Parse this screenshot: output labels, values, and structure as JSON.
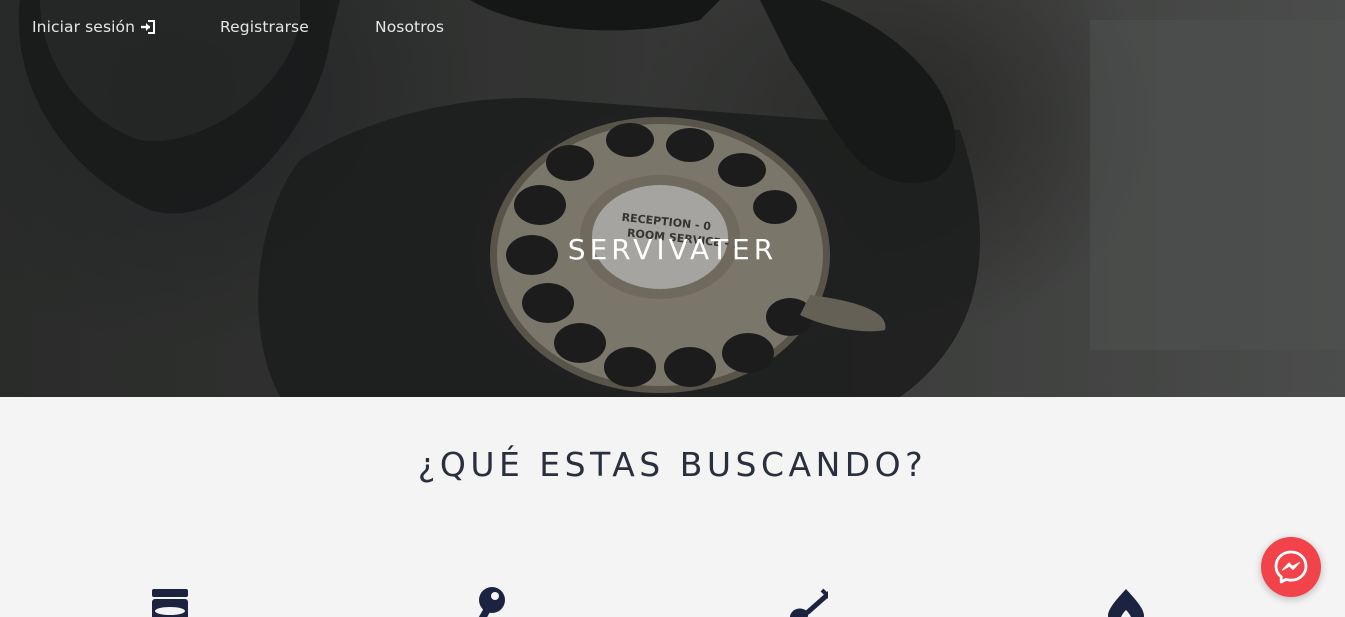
{
  "nav": {
    "login_label": "Iniciar sesión",
    "login_icon": "sign-in-icon",
    "register_label": "Registrarse",
    "about_label": "Nosotros"
  },
  "hero": {
    "brand": "SERVIVATER",
    "image": "rotary-telephone-photo",
    "dial_text_1": "RECEPTION - 0",
    "dial_text_2": "ROOM SERVICE - 1"
  },
  "section": {
    "title": "¿QUÉ ESTAS BUSCANDO?"
  },
  "services": [
    {
      "icon": "water-heater-icon"
    },
    {
      "icon": "key-icon"
    },
    {
      "icon": "paint-brush-icon"
    },
    {
      "icon": "gas-flame-icon"
    }
  ],
  "chat": {
    "icon": "messenger-icon",
    "color": "#f2424a"
  },
  "colors": {
    "title": "#2a2f3e",
    "icon": "#1c2340",
    "background": "#f4f4f4"
  }
}
